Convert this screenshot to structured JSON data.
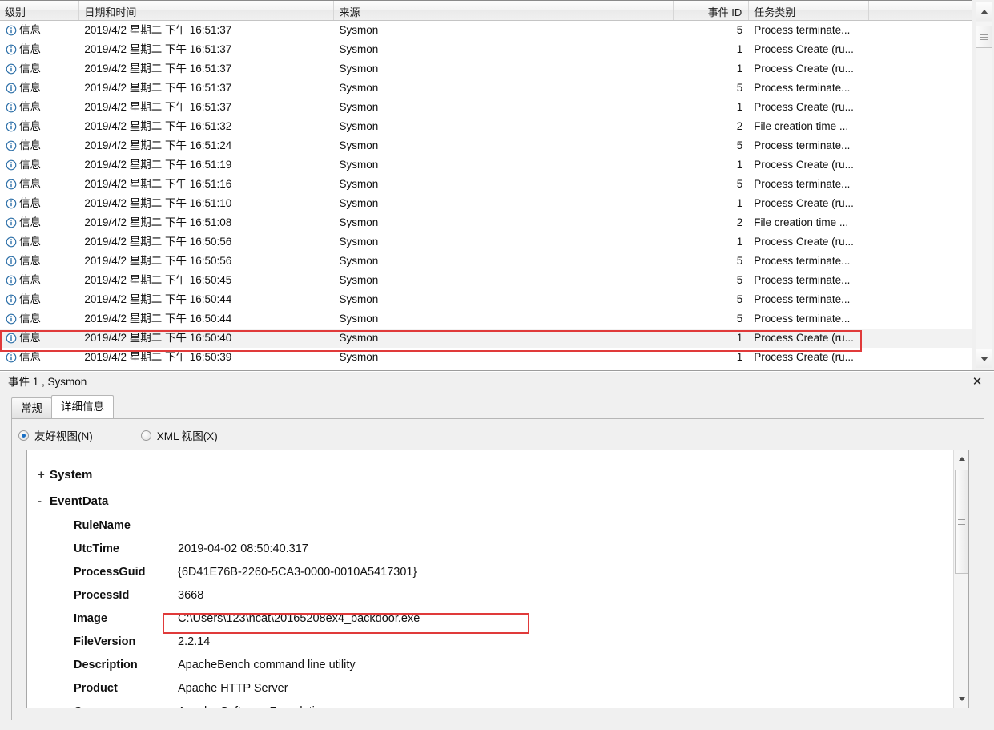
{
  "event_list": {
    "columns": [
      "级别",
      "日期和时间",
      "来源",
      "事件 ID",
      "任务类别"
    ],
    "rows": [
      {
        "level": "信息",
        "datetime": "2019/4/2 星期二 下午 16:51:37",
        "source": "Sysmon",
        "event_id": "5",
        "task": "Process terminate..."
      },
      {
        "level": "信息",
        "datetime": "2019/4/2 星期二 下午 16:51:37",
        "source": "Sysmon",
        "event_id": "1",
        "task": "Process Create (ru..."
      },
      {
        "level": "信息",
        "datetime": "2019/4/2 星期二 下午 16:51:37",
        "source": "Sysmon",
        "event_id": "1",
        "task": "Process Create (ru..."
      },
      {
        "level": "信息",
        "datetime": "2019/4/2 星期二 下午 16:51:37",
        "source": "Sysmon",
        "event_id": "5",
        "task": "Process terminate..."
      },
      {
        "level": "信息",
        "datetime": "2019/4/2 星期二 下午 16:51:37",
        "source": "Sysmon",
        "event_id": "1",
        "task": "Process Create (ru..."
      },
      {
        "level": "信息",
        "datetime": "2019/4/2 星期二 下午 16:51:32",
        "source": "Sysmon",
        "event_id": "2",
        "task": "File creation time ..."
      },
      {
        "level": "信息",
        "datetime": "2019/4/2 星期二 下午 16:51:24",
        "source": "Sysmon",
        "event_id": "5",
        "task": "Process terminate..."
      },
      {
        "level": "信息",
        "datetime": "2019/4/2 星期二 下午 16:51:19",
        "source": "Sysmon",
        "event_id": "1",
        "task": "Process Create (ru..."
      },
      {
        "level": "信息",
        "datetime": "2019/4/2 星期二 下午 16:51:16",
        "source": "Sysmon",
        "event_id": "5",
        "task": "Process terminate..."
      },
      {
        "level": "信息",
        "datetime": "2019/4/2 星期二 下午 16:51:10",
        "source": "Sysmon",
        "event_id": "1",
        "task": "Process Create (ru..."
      },
      {
        "level": "信息",
        "datetime": "2019/4/2 星期二 下午 16:51:08",
        "source": "Sysmon",
        "event_id": "2",
        "task": "File creation time ..."
      },
      {
        "level": "信息",
        "datetime": "2019/4/2 星期二 下午 16:50:56",
        "source": "Sysmon",
        "event_id": "1",
        "task": "Process Create (ru..."
      },
      {
        "level": "信息",
        "datetime": "2019/4/2 星期二 下午 16:50:56",
        "source": "Sysmon",
        "event_id": "5",
        "task": "Process terminate..."
      },
      {
        "level": "信息",
        "datetime": "2019/4/2 星期二 下午 16:50:45",
        "source": "Sysmon",
        "event_id": "5",
        "task": "Process terminate..."
      },
      {
        "level": "信息",
        "datetime": "2019/4/2 星期二 下午 16:50:44",
        "source": "Sysmon",
        "event_id": "5",
        "task": "Process terminate..."
      },
      {
        "level": "信息",
        "datetime": "2019/4/2 星期二 下午 16:50:44",
        "source": "Sysmon",
        "event_id": "5",
        "task": "Process terminate..."
      },
      {
        "level": "信息",
        "datetime": "2019/4/2 星期二 下午 16:50:40",
        "source": "Sysmon",
        "event_id": "1",
        "task": "Process Create (ru...",
        "selected": true,
        "highlighted": true
      },
      {
        "level": "信息",
        "datetime": "2019/4/2 星期二 下午 16:50:39",
        "source": "Sysmon",
        "event_id": "1",
        "task": "Process Create (ru..."
      }
    ]
  },
  "detail": {
    "title": "事件 1 , Sysmon",
    "close_label": "✕",
    "tabs": [
      {
        "label": "常规",
        "active": false
      },
      {
        "label": "详细信息",
        "active": true
      }
    ],
    "view_modes": [
      {
        "label": "友好视图(N)",
        "checked": true
      },
      {
        "label": "XML 视图(X)",
        "checked": false
      }
    ],
    "nodes": [
      {
        "toggle": "+",
        "label": "System"
      },
      {
        "toggle": "-",
        "label": "EventData"
      }
    ],
    "fields": [
      {
        "key": "RuleName",
        "value": ""
      },
      {
        "key": "UtcTime",
        "value": "2019-04-02 08:50:40.317"
      },
      {
        "key": "ProcessGuid",
        "value": "{6D41E76B-2260-5CA3-0000-0010A5417301}"
      },
      {
        "key": "ProcessId",
        "value": "3668"
      },
      {
        "key": "Image",
        "value": "C:\\Users\\123\\ncat\\20165208ex4_backdoor.exe",
        "highlighted": true
      },
      {
        "key": "FileVersion",
        "value": "2.2.14"
      },
      {
        "key": "Description",
        "value": "ApacheBench command line utility"
      },
      {
        "key": "Product",
        "value": "Apache HTTP Server"
      },
      {
        "key": "Company",
        "value": "Apache Software Foundation"
      }
    ]
  },
  "colors": {
    "highlight_red": "#e03a3a",
    "info_icon_blue": "#2c6fa8",
    "selected_row": "#f2f2f2"
  }
}
